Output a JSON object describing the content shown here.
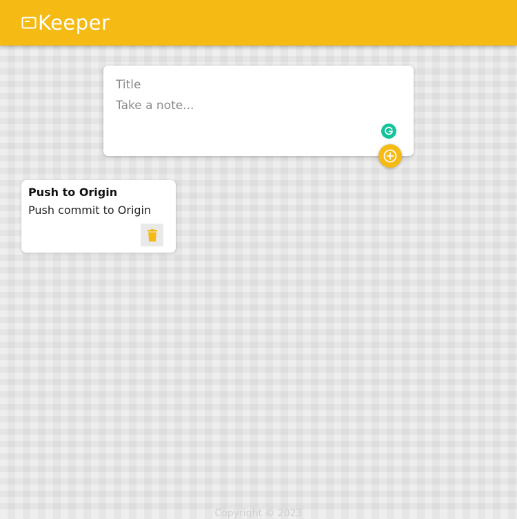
{
  "header": {
    "title": "Keeper",
    "icon": "note-icon",
    "color": "#f5ba13"
  },
  "create_note": {
    "title_placeholder": "Title",
    "content_placeholder": "Take a note...",
    "title_value": "",
    "content_value": "",
    "add_icon": "add-circle-icon",
    "grammarly_icon": "grammarly-icon",
    "grammarly_color": "#15c39a"
  },
  "notes": [
    {
      "title": "Push to Origin",
      "content": "Push commit to Origin",
      "delete_icon": "trash-icon"
    }
  ],
  "footer": {
    "text": "Copyright © 2023"
  }
}
